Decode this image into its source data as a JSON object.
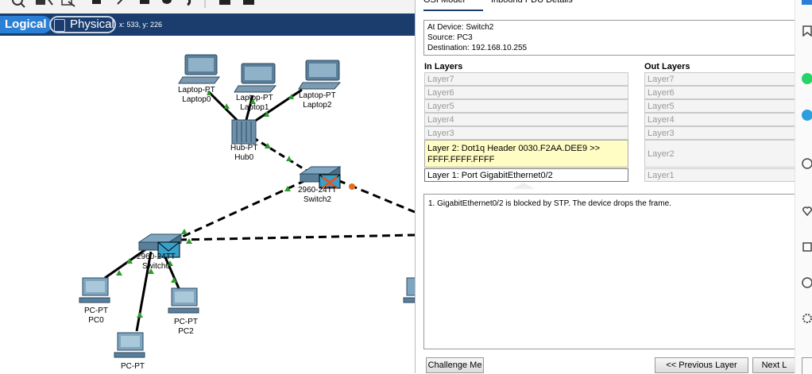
{
  "mode_bar": {
    "logical_label": "Logical",
    "physical_label": "Physical",
    "coords": "x: 533, y: 226"
  },
  "devices": {
    "laptop0": {
      "type": "Laptop-PT",
      "name": "Laptop0"
    },
    "laptop1": {
      "type": "Laptop-PT",
      "name": "Laptop1"
    },
    "laptop2": {
      "type": "Laptop-PT",
      "name": "Laptop2"
    },
    "hub0": {
      "type": "Hub-PT",
      "name": "Hub0"
    },
    "switch2": {
      "type": "2960-24TT",
      "name": "Switch2"
    },
    "switch0": {
      "type": "2960-24TT",
      "name": "Switch0"
    },
    "pc0": {
      "type": "PC-PT",
      "name": "PC0"
    },
    "pc2": {
      "type": "PC-PT",
      "name": "PC2"
    },
    "pc1": {
      "type": "PC-PT",
      "name": ""
    }
  },
  "panel": {
    "tab_osi": "OSI Model",
    "tab_inbound": "Inbound PDU Details",
    "at_device": "At Device: Switch2",
    "source": "Source: PC3",
    "destination": "Destination: 192.168.10.255",
    "in_layers_title": "In Layers",
    "out_layers_title": "Out Layers",
    "in_layers": [
      "Layer7",
      "Layer6",
      "Layer5",
      "Layer4",
      "Layer3",
      "Layer 2: Dot1q Header 0030.F2AA.DEE9 >> FFFF.FFFF.FFFF",
      "Layer 1: Port GigabitEthernet0/2"
    ],
    "out_layers": [
      "Layer7",
      "Layer6",
      "Layer5",
      "Layer4",
      "Layer3",
      "Layer2",
      "Layer1"
    ],
    "description": "1. GigabitEthernet0/2 is blocked by STP. The device drops the frame.",
    "challenge_btn": "Challenge Me",
    "prev_btn": "<< Previous Layer",
    "next_btn": "Next L"
  },
  "colors": {
    "mode_bar": "#1a3d6e",
    "logical_tab": "#2b7fd4",
    "link_up": "#2e9a2e",
    "link_blocked": "#e0701e",
    "highlight_layer": "#fffcc4"
  }
}
